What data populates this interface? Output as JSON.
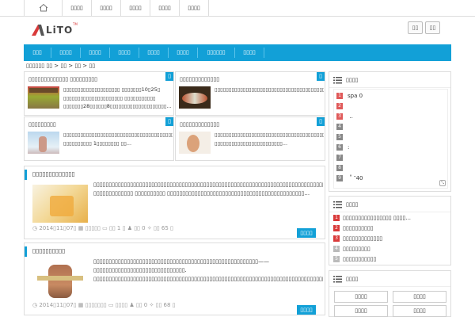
{
  "topbar": {
    "home_icon": "home-icon",
    "items": [
      "▯▯▯▯",
      "▯▯▯▯",
      "▯▯▯▯",
      "▯▯▯▯",
      "▯▯▯▯"
    ]
  },
  "header": {
    "logo_text": "LiTO",
    "logo_tm": "TM",
    "buttons": [
      "▯▯",
      "▯▯"
    ]
  },
  "nav": {
    "items": [
      "▯▯▯",
      "▯▯▯▯",
      "▯▯▯▯",
      "▯▯▯▯",
      "▯▯▯▯",
      "▯▯▯▯",
      "▯▯▯▯▯▯",
      "▯▯▯▯"
    ]
  },
  "breadcrumb": "▯▯▯▯▯▯ ▯▯ > ▯▯ > ▯▯ > ▯▯",
  "cards": [
    {
      "title": "▯▯▯▯▯▯▯▯▯▯▯▯▯ ▯▯▯▯▯▯▯▯▯",
      "corner": "▯",
      "text": "▯▯▯▯▯▯▯▯▯▯▯▯▯▯▯▯▯▯▯▯ ▯▯▯▯▯▯▯10▯25▯ ▯▯▯▯▯▯▯▯▯▯▯▯▯▯▯▯▯▯▯▯▯ ▯▯▯▯▯▯▯▯▯▯▯ ▯▯▯▯▯▯▯28▯▯▯▯▯▯8▯▯▯▯▯▯▯▯▯▯▯▯▯▯▯▯▯▯▯▯..."
    },
    {
      "title": "▯▯▯▯▯▯▯▯▯▯▯▯▯",
      "corner": "▯",
      "text": "▯▯▯▯▯▯▯▯▯▯▯▯▯▯▯▯▯▯▯▯▯▯▯▯▯▯▯▯▯▯▯▯▯▯▯▯▯▯▯▯▯▯▯▯▯▯▯▯▯▯▯▯▯▯▯▯▯▯▯▯▯▯▯▯▯▯▯▯▯▯▯▯▯▯▯▯▯▯▯▯▯▯▯▯▯▯▯▯▯▯▯▯..."
    },
    {
      "title": "▯▯▯▯▯▯▯▯▯",
      "corner": "▯",
      "text": "▯▯▯▯▯▯▯▯▯▯▯▯▯▯▯▯▯▯▯▯▯▯▯▯▯▯▯▯▯▯▯▯▯▯▯▯▯▯▯▯▯▯▯▯▯▯▯▯▯▯▯▯▯▯▯▯▯▯▯▯ ▯▯▯▯▯▯▯▯▯▯ 1▯▯▯▯▯▯▯▯ ▯▯..."
    },
    {
      "title": "▯▯▯▯▯▯▯▯▯▯▯▯▯",
      "corner": "▯",
      "text": "▯▯▯▯▯▯▯▯▯▯▯▯▯▯▯▯▯▯▯▯▯▯▯▯▯▯▯▯▯▯▯▯▯▯▯▯▯▯▯▯▯▯▯▯▯▯▯▯▯▯▯▯▯▯▯▯▯▯▯▯▯▯▯▯▯▯▯?▯▯▯▯▯▯▯▯▯▯▯▯▯▯▯▯▯▯▯▯▯▯▯▯..."
    }
  ],
  "posts": [
    {
      "title": "▯▯▯▯▯▯▯▯▯▯▯▯▯",
      "text": "▯▯▯▯▯▯▯▯▯▯▯▯▯▯▯▯▯▯▯▯▯▯▯▯▯▯▯▯▯▯▯▯▯▯▯▯▯▯▯▯▯▯▯▯▯▯▯▯▯▯▯▯▯▯▯▯▯▯▯▯▯▯▯▯▯▯▯▯▯▯▯▯▯▯▯▯▯▯▯▯▯▯▯▯▯▯▯▯▯▯▯ ▯▯▯▯▯▯▯▯▯▯▯▯▯ ▯▯▯▯▯▯▯▯▯▯ ▯▯▯▯▯▯▯▯▯▯▯▯▯▯▯▯▯▯▯▯▯▯▯▯▯▯▯▯▯▯▯▯▯▯▯▯▯▯▯▯▯▯▯▯▯...",
      "date": "2014▯11▯07▯",
      "cat": "▯▯▯▯▯",
      "comments": "▯▯ 1 ▯",
      "likes": "▯▯ 0",
      "views": "▯▯ 65 ▯",
      "more": "▯▯▯▯"
    },
    {
      "title": "▯▯▯▯▯▯▯▯▯▯",
      "text": "▯▯▯▯▯▯▯▯▯▯▯▯▯▯▯▯▯▯▯▯▯▯▯▯▯▯▯▯▯▯▯▯▯▯▯▯▯▯▯▯▯▯▯▯▯▯▯▯▯▯▯▯▯▯——▯▯▯▯▯▯▯▯▯▯▯▯▯▯▯▯▯▯▯▯▯▯▯▯▯▯▯▯▯▯. ▯▯▯▯▯▯▯▯▯▯▯▯▯▯▯▯▯▯▯▯▯▯▯▯▯▯▯▯▯▯▯▯▯▯▯▯▯▯▯▯▯▯▯▯▯▯▯▯▯▯▯▯▯▯▯▯▯▯▯▯▯▯▯▯▯▯▯▯▯▯▯▯▯▯▯▯▯▯▯▯▯▯▯▯▯▯▯▯▯▯▯▯▯▯▯▯▯▯▯▯▯▯▯▯▯▯▯▯▯▯▯▯▯▯▯▯▯▯▯▯▯▯...",
      "date": "2014▯11▯07▯",
      "cat": "▯▯▯▯▯▯▯",
      "comments": "▯▯▯▯",
      "likes": "▯▯ 0",
      "views": "▯▯ 68 ▯",
      "more": "▯▯▯▯"
    }
  ],
  "tagcloud": {
    "title": "▯▯▯▯",
    "rows": [
      {
        "n": "1",
        "t": "spa     0",
        "c": "#e05a5a"
      },
      {
        "n": "2",
        "t": "",
        "c": "#e05a5a"
      },
      {
        "n": "3",
        "t": "   ‥",
        "c": "#e05a5a"
      },
      {
        "n": "4",
        "t": "",
        "c": "#888888"
      },
      {
        "n": "5",
        "t": "",
        "c": "#888888"
      },
      {
        "n": "6",
        "t": ":",
        "c": "#888888"
      },
      {
        "n": "7",
        "t": "",
        "c": "#888888"
      },
      {
        "n": "8",
        "t": "",
        "c": "#888888"
      },
      {
        "n": "9",
        "t": "   ˚ ‶40",
        "c": "#888888"
      }
    ]
  },
  "ranking": {
    "title": "▯▯▯▯",
    "items": [
      {
        "n": "1",
        "t": "▯▯▯▯▯▯▯▯▯▯▯▯▯▯▯▯ ▯▯▯▯...",
        "c": "#d93a3a"
      },
      {
        "n": "2",
        "t": "▯▯▯▯▯▯▯▯▯▯",
        "c": "#d93a3a"
      },
      {
        "n": "3",
        "t": "▯▯▯▯▯▯▯▯▯▯▯▯▯",
        "c": "#d93a3a"
      },
      {
        "n": "4",
        "t": "▯▯▯▯▯▯▯▯▯",
        "c": "#bbbbbb"
      },
      {
        "n": "5",
        "t": "▯▯▯▯▯▯▯▯▯▯▯",
        "c": "#bbbbbb"
      }
    ]
  },
  "links": {
    "title": "▯▯▯▯",
    "items": [
      "▯▯▯▯",
      "▯▯▯▯",
      "▯▯▯▯",
      "▯▯▯▯"
    ]
  },
  "colors": {
    "accent": "#12a0d7",
    "rank_top": "#d93a3a",
    "rank_rest": "#bbbbbb"
  }
}
